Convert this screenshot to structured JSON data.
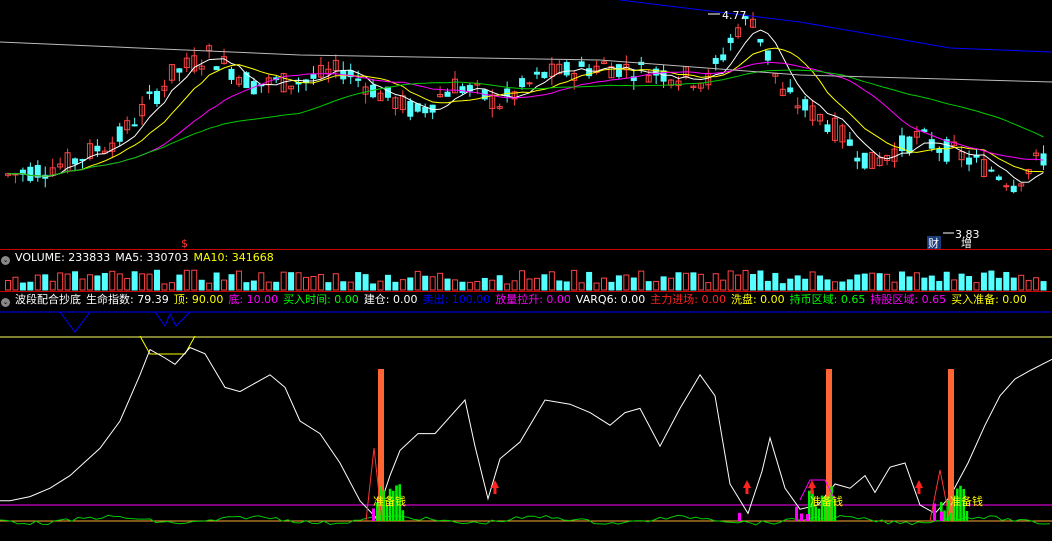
{
  "colors": {
    "up": "#ff4444",
    "down": "#54ffff",
    "ma_white": "#ffffff",
    "ma_yellow": "#ffff00",
    "ma_magenta": "#ff00ff",
    "ma_green": "#00cc00",
    "ma_blue": "#0000ff",
    "ma_gray": "#bbbbbb",
    "separator": "#cc0000"
  },
  "price_panel": {
    "high_label": "4.77",
    "low_label": "3.83",
    "s_marker": "$",
    "cai_badge": "财",
    "zeng_badge": "增"
  },
  "volume_header": {
    "label": "VOLUME: 233833",
    "ma5": "MA5: 330703",
    "ma10": "MA10: 341668"
  },
  "indicator_header": {
    "name": "波段配合抄底",
    "items": [
      {
        "text": "生命指数: 79.39",
        "color": "#ffffff"
      },
      {
        "text": "顶: 90.00",
        "color": "#ffff00"
      },
      {
        "text": "底: 10.00",
        "color": "#ff00ff"
      },
      {
        "text": "买入时间: 0.00",
        "color": "#00ff00"
      },
      {
        "text": "建仓: 0.00",
        "color": "#ffffff"
      },
      {
        "text": "卖出: 100.00",
        "color": "#0000ff"
      },
      {
        "text": "放量拉升: 0.00",
        "color": "#ff00ff"
      },
      {
        "text": "VARQ6: 0.00",
        "color": "#ffffff"
      },
      {
        "text": "主力进场: 0.00",
        "color": "#ff2222"
      },
      {
        "text": "洗盘: 0.00",
        "color": "#ffff00"
      },
      {
        "text": "持币区域: 0.65",
        "color": "#00ff00"
      },
      {
        "text": "持股区域: 0.65",
        "color": "#ff00ff"
      },
      {
        "text": "买入准备: 0.00",
        "color": "#ffff00"
      }
    ]
  },
  "annotations": [
    "准备钱",
    "准备钱",
    "准备钱"
  ],
  "chart_data": [
    {
      "type": "candlestick",
      "panel": "price",
      "n_bars": 140,
      "ylim": [
        3.55,
        4.82
      ],
      "high": 4.77,
      "low": 3.83,
      "moving_averages": [
        "white",
        "yellow",
        "magenta",
        "green",
        "gray",
        "blue"
      ]
    },
    {
      "type": "bar",
      "panel": "volume",
      "series": [
        "VOLUME",
        "MA5",
        "MA10"
      ],
      "VOLUME": 233833,
      "MA5": 330703,
      "MA10": 341668
    },
    {
      "type": "line",
      "panel": "indicator",
      "ylim": [
        0,
        100
      ],
      "series": [
        {
          "name": "生命指数",
          "last": 79.39
        },
        {
          "name": "顶",
          "value": 90
        },
        {
          "name": "底",
          "value": 10
        }
      ],
      "life_index_points": [
        [
          0,
          12
        ],
        [
          10,
          12
        ],
        [
          30,
          14
        ],
        [
          50,
          18
        ],
        [
          70,
          24
        ],
        [
          100,
          37
        ],
        [
          120,
          50
        ],
        [
          140,
          72
        ],
        [
          150,
          84
        ],
        [
          165,
          80
        ],
        [
          175,
          77
        ],
        [
          190,
          85
        ],
        [
          205,
          82
        ],
        [
          225,
          66
        ],
        [
          240,
          64
        ],
        [
          270,
          72
        ],
        [
          285,
          66
        ],
        [
          300,
          50
        ],
        [
          320,
          44
        ],
        [
          340,
          30
        ],
        [
          360,
          12
        ],
        [
          376,
          4
        ],
        [
          390,
          24
        ],
        [
          400,
          36
        ],
        [
          418,
          44
        ],
        [
          435,
          44
        ],
        [
          450,
          52
        ],
        [
          465,
          60
        ],
        [
          475,
          38
        ],
        [
          488,
          13
        ],
        [
          500,
          32
        ],
        [
          520,
          40
        ],
        [
          545,
          60
        ],
        [
          570,
          58
        ],
        [
          590,
          54
        ],
        [
          610,
          48
        ],
        [
          625,
          54
        ],
        [
          640,
          56
        ],
        [
          660,
          38
        ],
        [
          680,
          56
        ],
        [
          700,
          72
        ],
        [
          715,
          62
        ],
        [
          730,
          20
        ],
        [
          748,
          6
        ],
        [
          762,
          26
        ],
        [
          770,
          42
        ],
        [
          785,
          18
        ],
        [
          800,
          8
        ],
        [
          818,
          10
        ],
        [
          835,
          20
        ],
        [
          850,
          18
        ],
        [
          865,
          24
        ],
        [
          875,
          16
        ],
        [
          890,
          28
        ],
        [
          905,
          30
        ],
        [
          920,
          10
        ],
        [
          935,
          6
        ],
        [
          950,
          14
        ],
        [
          968,
          30
        ],
        [
          985,
          48
        ],
        [
          1000,
          62
        ],
        [
          1015,
          70
        ],
        [
          1030,
          74
        ],
        [
          1052,
          79.39
        ]
      ],
      "tall_bars_x": [
        381,
        829,
        951
      ],
      "red_arrows_x": [
        495,
        747,
        812,
        919
      ]
    }
  ]
}
